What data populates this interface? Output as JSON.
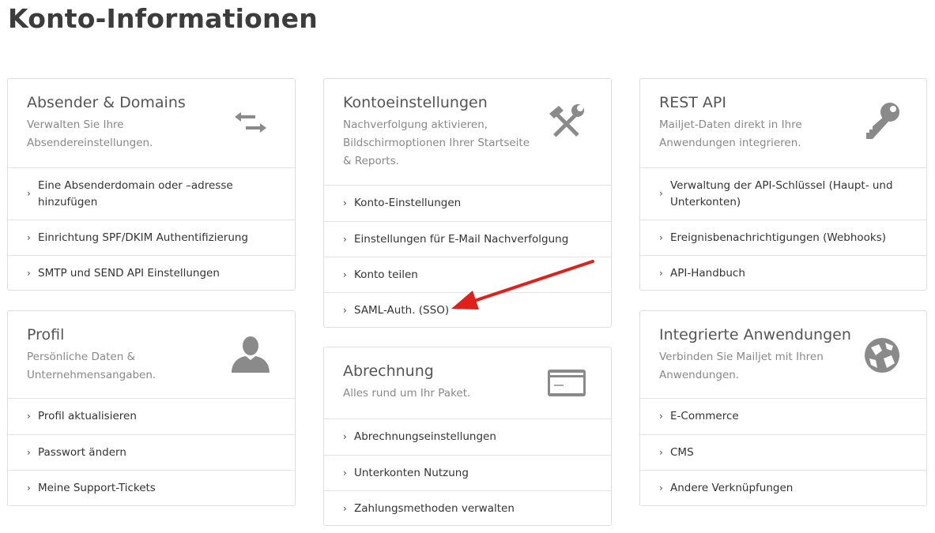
{
  "page": {
    "title": "Konto-Informationen"
  },
  "cards": {
    "absender": {
      "title": "Absender & Domains",
      "desc": "Verwalten Sie Ihre Absendereinstellungen.",
      "icon": "swap-arrows-icon",
      "items": [
        "Eine Absenderdomain oder –adresse hinzufügen",
        "Einrichtung SPF/DKIM Authentifizierung",
        "SMTP und SEND API Einstellungen"
      ]
    },
    "profil": {
      "title": "Profil",
      "desc": "Persönliche Daten & Unternehmensangaben.",
      "icon": "user-icon",
      "items": [
        "Profil aktualisieren",
        "Passwort ändern",
        "Meine Support-Tickets"
      ]
    },
    "konto": {
      "title": "Kontoeinstellungen",
      "desc": "Nachverfolgung aktivieren, Bildschirmoptionen Ihrer Startseite & Reports.",
      "icon": "tools-icon",
      "items": [
        "Konto-Einstellungen",
        "Einstellungen für E-Mail Nachverfolgung",
        "Konto teilen",
        "SAML-Auth. (SSO)"
      ]
    },
    "abrechnung": {
      "title": "Abrechnung",
      "desc": "Alles rund um Ihr Paket.",
      "icon": "credit-card-icon",
      "items": [
        "Abrechnungseinstellungen",
        "Unterkonten Nutzung",
        "Zahlungsmethoden verwalten"
      ]
    },
    "rest": {
      "title": "REST API",
      "desc": "Mailjet-Daten direkt in Ihre Anwendungen integrieren.",
      "icon": "key-icon",
      "items": [
        "Verwaltung der API-Schlüssel (Haupt- und Unterkonten)",
        "Ereignisbenachrichtigungen (Webhooks)",
        "API-Handbuch"
      ]
    },
    "integriert": {
      "title": "Integrierte Anwendungen",
      "desc": "Verbinden Sie Mailjet mit Ihren Anwendungen.",
      "icon": "globe-icon",
      "items": [
        "E-Commerce",
        "CMS",
        "Andere Verknüpfungen"
      ]
    }
  },
  "colors": {
    "icon": "#8a8a8a",
    "annotation_arrow": "#e0201b",
    "border": "#dedede"
  }
}
